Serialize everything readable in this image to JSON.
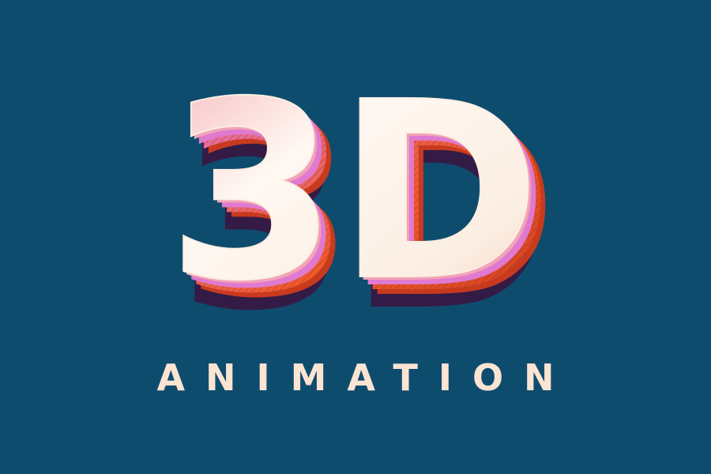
{
  "headline": {
    "text": "3D",
    "face_color": "#fbeee2",
    "face_highlight": "#fff8f2",
    "bevel_pink": "#f2a3b6",
    "side_orange": "#f05a2a",
    "side_magenta": "#e07ad0",
    "shadow_color": "#3b1340"
  },
  "subtitle": {
    "text": "ANIMATION",
    "color": "#fbe4d2"
  },
  "background": {
    "color": "#0e4c6e"
  }
}
